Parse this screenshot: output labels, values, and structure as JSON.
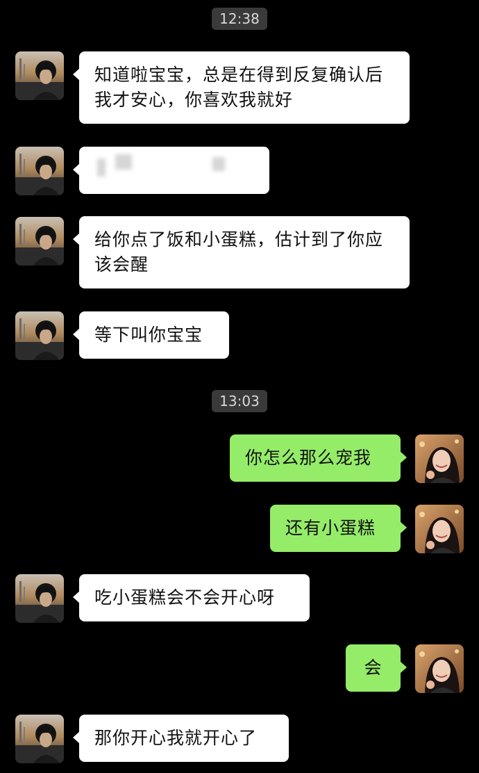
{
  "theme": {
    "background": "#000000",
    "incoming_bubble": "#ffffff",
    "outgoing_bubble": "#95ec69",
    "timestamp_pill": "#3a3a3a"
  },
  "timestamps": {
    "first": "12:38",
    "second": "13:03"
  },
  "messages": [
    {
      "side": "incoming",
      "avatar": "boy-avatar",
      "text": "知道啦宝宝，总是在得到反复确认后我才安心，你喜欢我就好"
    },
    {
      "side": "incoming",
      "avatar": "boy-avatar",
      "text": ""
    },
    {
      "side": "incoming",
      "avatar": "boy-avatar",
      "text": "给你点了饭和小蛋糕，估计到了你应该会醒"
    },
    {
      "side": "incoming",
      "avatar": "boy-avatar",
      "text": "等下叫你宝宝"
    },
    {
      "side": "outgoing",
      "avatar": "girl-avatar",
      "text": "你怎么那么宠我"
    },
    {
      "side": "outgoing",
      "avatar": "girl-avatar",
      "text": "还有小蛋糕"
    },
    {
      "side": "incoming",
      "avatar": "boy-avatar",
      "text": "吃小蛋糕会不会开心呀"
    },
    {
      "side": "outgoing",
      "avatar": "girl-avatar",
      "text": "会"
    },
    {
      "side": "incoming",
      "avatar": "boy-avatar",
      "text": "那你开心我就开心了"
    }
  ]
}
